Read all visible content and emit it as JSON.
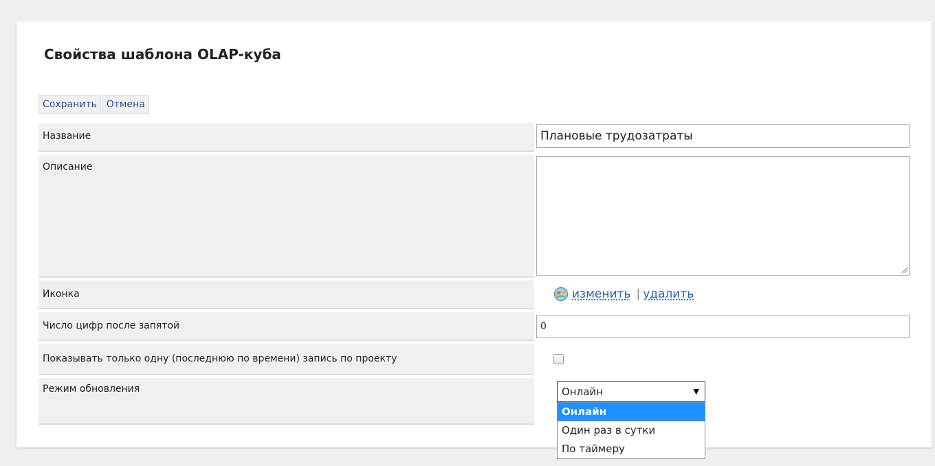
{
  "page": {
    "title": "Свойства шаблона OLAP-куба"
  },
  "toolbar": {
    "save_label": "Сохранить",
    "cancel_label": "Отмена"
  },
  "fields": {
    "name": {
      "label": "Название",
      "value": "Плановые трудозатраты"
    },
    "description": {
      "label": "Описание",
      "value": ""
    },
    "icon": {
      "label": "Иконка",
      "icon_name": "olap-cube-icon",
      "change_label": "изменить",
      "separator": "|",
      "delete_label": "удалить"
    },
    "decimals": {
      "label": "Число цифр после запятой",
      "value": "0"
    },
    "last_record_only": {
      "label": "Показывать только одну (последнюю по времени) запись по проекту",
      "checked": false
    },
    "update_mode": {
      "label": "Режим обновления",
      "selected": "Онлайн",
      "arrow": "▼",
      "options": [
        "Онлайн",
        "Один раз в сутки",
        "По таймеру"
      ],
      "highlighted_option": "Онлайн"
    }
  },
  "colors": {
    "link": "#2a5fb0",
    "button_text": "#2a4f9a",
    "label_bg": "#f0f0f0",
    "dropdown_highlight": "#1e90ff"
  }
}
